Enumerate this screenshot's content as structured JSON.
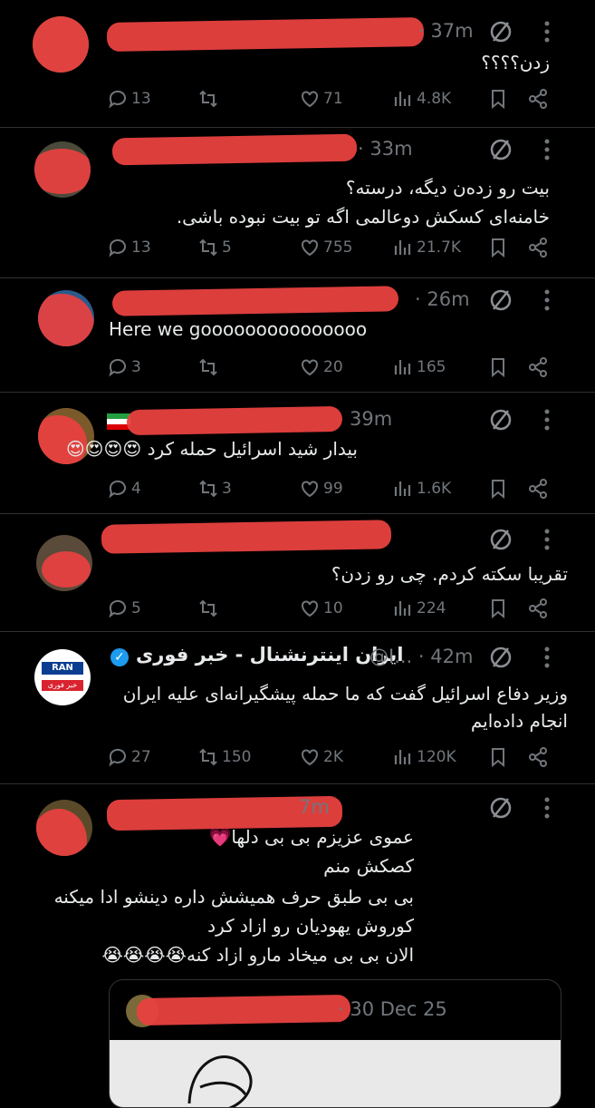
{
  "tweets": [
    {
      "time": "· 37m",
      "text": [
        "زدن؟؟؟؟"
      ],
      "replies": "13",
      "retweets": "",
      "likes": "71",
      "views": "4.8K"
    },
    {
      "time": "· 33m",
      "text": [
        "بیت رو زدەن دیگه، درسته؟",
        "خامنه‌ای کسکش دوعالمی اگه تو بیت نبوده باشی."
      ],
      "replies": "13",
      "retweets": "5",
      "likes": "755",
      "views": "21.7K"
    },
    {
      "time": "· 26m",
      "text": [
        "Here we gooooooooooooooo"
      ],
      "replies": "3",
      "retweets": "",
      "likes": "20",
      "views": "165"
    },
    {
      "time": "39m",
      "text": [
        "بیدار شید اسرائیل حمله کرد 😍😍😍😍"
      ],
      "replies": "4",
      "retweets": "3",
      "likes": "99",
      "views": "1.6K"
    },
    {
      "time": "",
      "text": [
        "تقریبا سکته کردم. چی رو زدن؟"
      ],
      "replies": "5",
      "retweets": "",
      "likes": "10",
      "views": "224"
    },
    {
      "name": "ایران اینترنشنال - خبر فوری",
      "handle": "@I...",
      "time": "· 42m",
      "logo_top": "RAN",
      "logo_mid": "ایران",
      "logo_bottom": "خبر فوری",
      "text": [
        "وزیر دفاع اسرائیل گفت که ما حمله پیشگیرانه‌ای علیه ایران",
        "انجام داده‌ایم"
      ],
      "replies": "27",
      "retweets": "150",
      "likes": "2K",
      "views": "120K"
    },
    {
      "time": "7m",
      "text": [
        "عموی عزیزم بی بی دلها💗",
        "کصکش منم",
        "بی بی طبق حرف همیشش داره دینشو ادا میکنه",
        "کوروش یهودیان رو ازاد کرد",
        "الان بی بی میخاد مارو ازاد کنه😭😭😭😭"
      ]
    }
  ],
  "quote": {
    "date": "· 30 Dec 25"
  }
}
